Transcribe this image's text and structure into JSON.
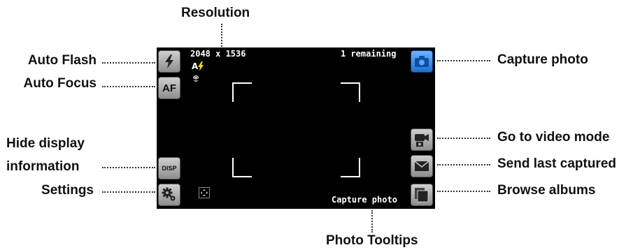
{
  "callouts": {
    "resolution": "Resolution",
    "auto_flash": "Auto Flash",
    "auto_focus": "Auto Focus",
    "hide_display_line1": "Hide display",
    "hide_display_line2": "information",
    "settings": "Settings",
    "capture_photo": "Capture photo",
    "video_mode": "Go to video mode",
    "send_last": "Send last captured",
    "browse_albums": "Browse albums",
    "photo_tooltips": "Photo Tooltips"
  },
  "viewfinder": {
    "resolution_text": "2048 x 1536",
    "remaining_text": "1 remaining",
    "tooltip_text": "Capture photo",
    "flash_indicator": "A",
    "af_label": "AF",
    "disp_label": "DISP"
  },
  "icons": [
    "flash-icon",
    "af-icon",
    "disp-icon",
    "settings-gears-icon",
    "focus-area-icon",
    "camera-icon",
    "video-camera-icon",
    "envelope-icon",
    "albums-icon",
    "macro-flower-icon"
  ],
  "colors": {
    "screen_bg": "#000000",
    "capture_button": "#2d83e6",
    "flash_indicator": "#ffd200"
  }
}
